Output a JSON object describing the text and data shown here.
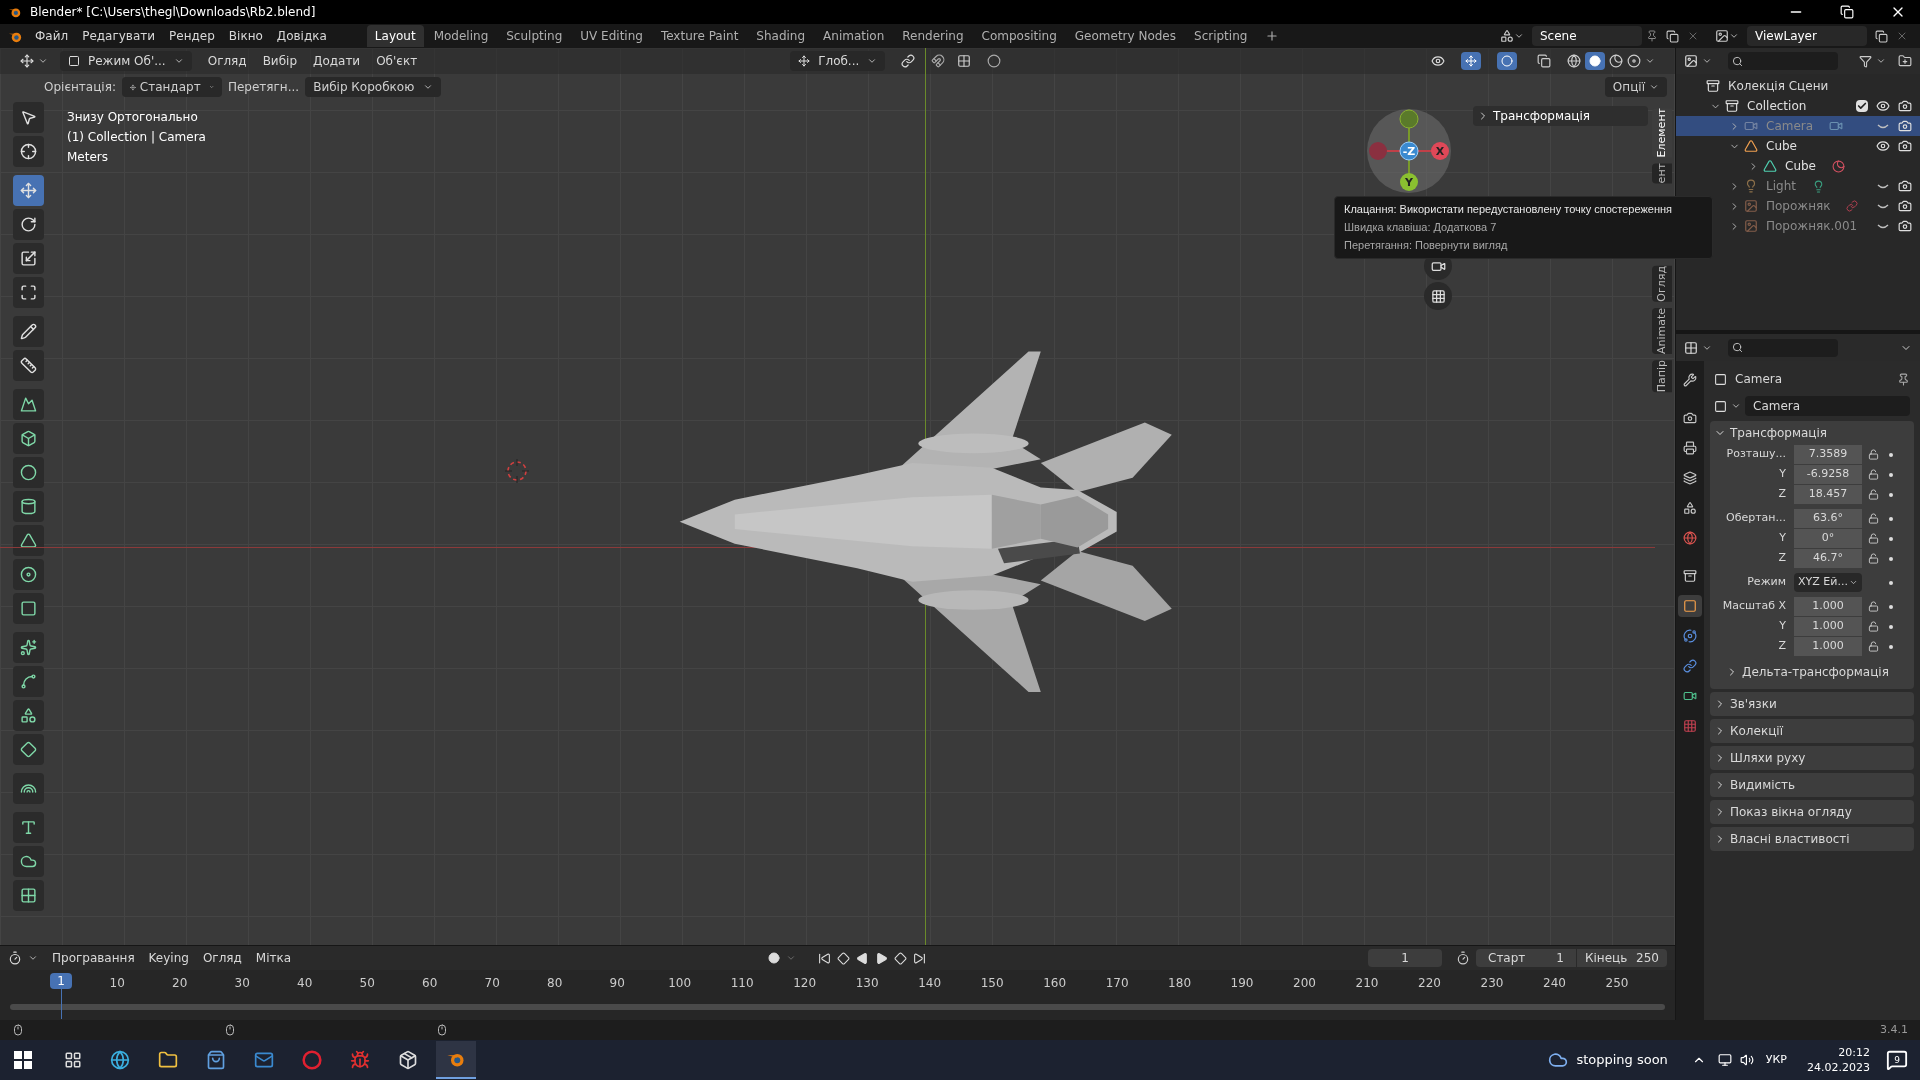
{
  "window": {
    "title": "Blender* [C:\\Users\\thegl\\Downloads\\Rb2.blend]"
  },
  "menu": [
    "Файл",
    "Редагувати",
    "Рендер",
    "Вікно",
    "Довідка"
  ],
  "workspaces": [
    {
      "label": "Layout",
      "selected": true
    },
    {
      "label": "Modeling",
      "selected": false
    },
    {
      "label": "Sculpting",
      "selected": false
    },
    {
      "label": "UV Editing",
      "selected": false
    },
    {
      "label": "Texture Paint",
      "selected": false
    },
    {
      "label": "Shading",
      "selected": false
    },
    {
      "label": "Animation",
      "selected": false
    },
    {
      "label": "Rendering",
      "selected": false
    },
    {
      "label": "Compositing",
      "selected": false
    },
    {
      "label": "Geometry Nodes",
      "selected": false
    },
    {
      "label": "Scripting",
      "selected": false
    }
  ],
  "scene": "Scene",
  "view_layer": "ViewLayer",
  "viewport_header": {
    "mode": "Режим Об'...",
    "menus": [
      "Огляд",
      "Вибір",
      "Додати",
      "Об'єкт"
    ],
    "orientation": "Глоб..."
  },
  "tool_settings": {
    "orientation_label": "Орієнтація:",
    "orientation": "Стандарт",
    "drag_label": "Перетягн...",
    "drag": "Вибір Коробкою",
    "options": "Опції"
  },
  "viewport_info": [
    "Знизу Ортогонально",
    "(1) Collection | Camera",
    "Meters"
  ],
  "tool_groups": [
    [
      {
        "kind": "select",
        "selected": false
      },
      {
        "kind": "cursor",
        "selected": false
      }
    ],
    [
      {
        "kind": "move",
        "selected": true
      },
      {
        "kind": "rotate",
        "selected": false
      },
      {
        "kind": "scale",
        "selected": false
      },
      {
        "kind": "transform",
        "selected": false
      }
    ],
    [
      {
        "kind": "annotate",
        "selected": false
      },
      {
        "kind": "measure",
        "selected": false
      }
    ],
    [
      {
        "kind": "add_plane",
        "selected": false
      },
      {
        "kind": "add_cube",
        "selected": false
      },
      {
        "kind": "add_sphere",
        "selected": false
      },
      {
        "kind": "add_cylinder",
        "selected": false
      },
      {
        "kind": "add_cone",
        "selected": false
      },
      {
        "kind": "add_torus",
        "selected": false
      },
      {
        "kind": "add_wedge",
        "selected": false
      }
    ],
    [
      {
        "kind": "add_mesh",
        "selected": false
      },
      {
        "kind": "add_curve",
        "selected": false
      },
      {
        "kind": "add_surface",
        "selected": false
      },
      {
        "kind": "add_meta",
        "selected": false
      }
    ],
    [
      {
        "kind": "add_arc",
        "selected": false
      }
    ],
    [
      {
        "kind": "add_text",
        "selected": false
      },
      {
        "kind": "add_volume",
        "selected": false
      },
      {
        "kind": "add_lattice",
        "selected": false
      }
    ]
  ],
  "n_panel": {
    "section": "Трансформація",
    "tabs": [
      {
        "label": "Елемент",
        "selected": true
      },
      {
        "label": "ент",
        "selected": false
      },
      {
        "label": "Огляд",
        "selected": false
      },
      {
        "label": "Animate",
        "selected": false
      },
      {
        "label": "Папір",
        "selected": false
      }
    ]
  },
  "gizmo": {
    "center": "-Z",
    "right": "X",
    "bottom": "Y"
  },
  "tooltip": [
    "Клацання: Використати передустановлену точку спостереження",
    "Швидка клавіша: Додаткова 7",
    "Перетягання: Повернути вигляд"
  ],
  "outliner": {
    "root": "Колекція Сцени",
    "items": [
      {
        "label": "Collection",
        "kind": "collection",
        "expanded": true,
        "selected": false,
        "checked": true,
        "visible": true,
        "children": [
          {
            "label": "Camera",
            "kind": "camera",
            "expanded": false,
            "selected": true,
            "visible": false
          },
          {
            "label": "Cube",
            "kind": "mesh",
            "expanded": true,
            "selected": false,
            "visible": true,
            "children": [
              {
                "label": "Cube",
                "kind": "meshdata",
                "expanded": false,
                "selected": false
              }
            ]
          },
          {
            "label": "Light",
            "kind": "light",
            "expanded": false,
            "selected": false,
            "visible": false
          },
          {
            "label": "Порожняк",
            "kind": "empty",
            "expanded": false,
            "selected": false,
            "visible": false,
            "constraint": true
          },
          {
            "label": "Порожняк.001",
            "kind": "empty",
            "expanded": false,
            "selected": false,
            "visible": false,
            "constraint": false
          }
        ]
      }
    ]
  },
  "properties": {
    "tabs": [
      {
        "kind": "tool",
        "selected": false
      },
      {
        "kind": "render",
        "selected": false
      },
      {
        "kind": "output",
        "selected": false
      },
      {
        "kind": "view_layer",
        "selected": false
      },
      {
        "kind": "scene",
        "selected": false
      },
      {
        "kind": "world",
        "selected": false
      },
      {
        "kind": "collection",
        "selected": false
      },
      {
        "kind": "object",
        "selected": true
      },
      {
        "kind": "physics",
        "selected": false
      },
      {
        "kind": "constraints",
        "selected": false
      },
      {
        "kind": "data",
        "selected": false
      },
      {
        "kind": "texture",
        "selected": false
      }
    ],
    "object": "Camera",
    "name": "Camera",
    "transform": {
      "title": "Трансформація",
      "expanded": true,
      "groups": [
        [
          {
            "label": "Розташу...",
            "value": "7.3589"
          },
          {
            "label": "Y",
            "value": "-6.9258"
          },
          {
            "label": "Z",
            "value": "18.457"
          }
        ],
        [
          {
            "label": "Обертан...",
            "value": "63.6°"
          },
          {
            "label": "Y",
            "value": "0°"
          },
          {
            "label": "Z",
            "value": "46.7°"
          }
        ],
        [
          {
            "label": "Режим",
            "value": "XYZ Ей...",
            "kind": "dropdown"
          }
        ],
        [
          {
            "label": "Масштаб X",
            "value": "1.000"
          },
          {
            "label": "Y",
            "value": "1.000"
          },
          {
            "label": "Z",
            "value": "1.000"
          }
        ]
      ],
      "subpanel": "Дельта-трансформація"
    },
    "panels": [
      {
        "title": "Зв'язки",
        "expanded": false
      },
      {
        "title": "Колекції",
        "expanded": false
      },
      {
        "title": "Шляхи руху",
        "expanded": false
      },
      {
        "title": "Видимість",
        "expanded": false
      },
      {
        "title": "Показ вікна огляду",
        "expanded": false
      },
      {
        "title": "Власні властивості",
        "expanded": false
      }
    ]
  },
  "timeline": {
    "menus": [
      "Програвання",
      "Keying",
      "Огляд",
      "Мітка"
    ],
    "current_frame": "1",
    "start_label": "Старт",
    "start": "1",
    "end_label": "Кінець",
    "end": "250",
    "playhead": "1",
    "ruler": [
      "10",
      "20",
      "30",
      "40",
      "50",
      "60",
      "70",
      "80",
      "90",
      "100",
      "110",
      "120",
      "130",
      "140",
      "150",
      "160",
      "170",
      "180",
      "190",
      "200",
      "210",
      "220",
      "230",
      "240",
      "250"
    ]
  },
  "status": {
    "version": "3.4.1"
  },
  "taskbar": {
    "weather": "stopping soon",
    "language": "УКР",
    "time": "20:12",
    "date": "24.02.2023",
    "notifications": "9"
  }
}
